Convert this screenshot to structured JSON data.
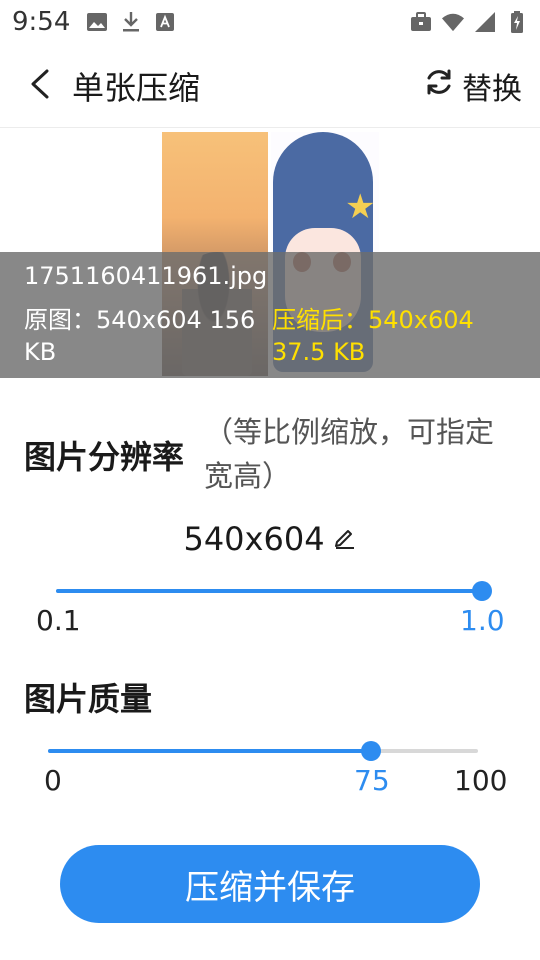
{
  "status_bar": {
    "time": "9:54",
    "left_icons": [
      "image-icon",
      "download-icon",
      "a-icon"
    ],
    "right_icons": [
      "briefcase-icon",
      "wifi-icon",
      "signal-icon",
      "battery-icon"
    ]
  },
  "toolbar": {
    "title": "单张压缩",
    "replace_label": "替换"
  },
  "preview": {
    "file_name": "1751160411961.jpg",
    "original_info": "原图：540x604  156 KB",
    "compressed_info": "压缩后：540x604 37.5 KB"
  },
  "resolution": {
    "heading": "图片分辨率",
    "hint": "（等比例缩放，可指定宽高）",
    "value": "540x604",
    "min_label": "0.1",
    "max_label": "1.0",
    "fraction": 1.0
  },
  "quality": {
    "heading": "图片质量",
    "min_label": "0",
    "current_label": "75",
    "max_label": "100",
    "fraction": 0.75
  },
  "action": {
    "save_label": "压缩并保存"
  },
  "colors": {
    "accent": "#2d8cf0",
    "highlight_text": "#ffe000"
  }
}
